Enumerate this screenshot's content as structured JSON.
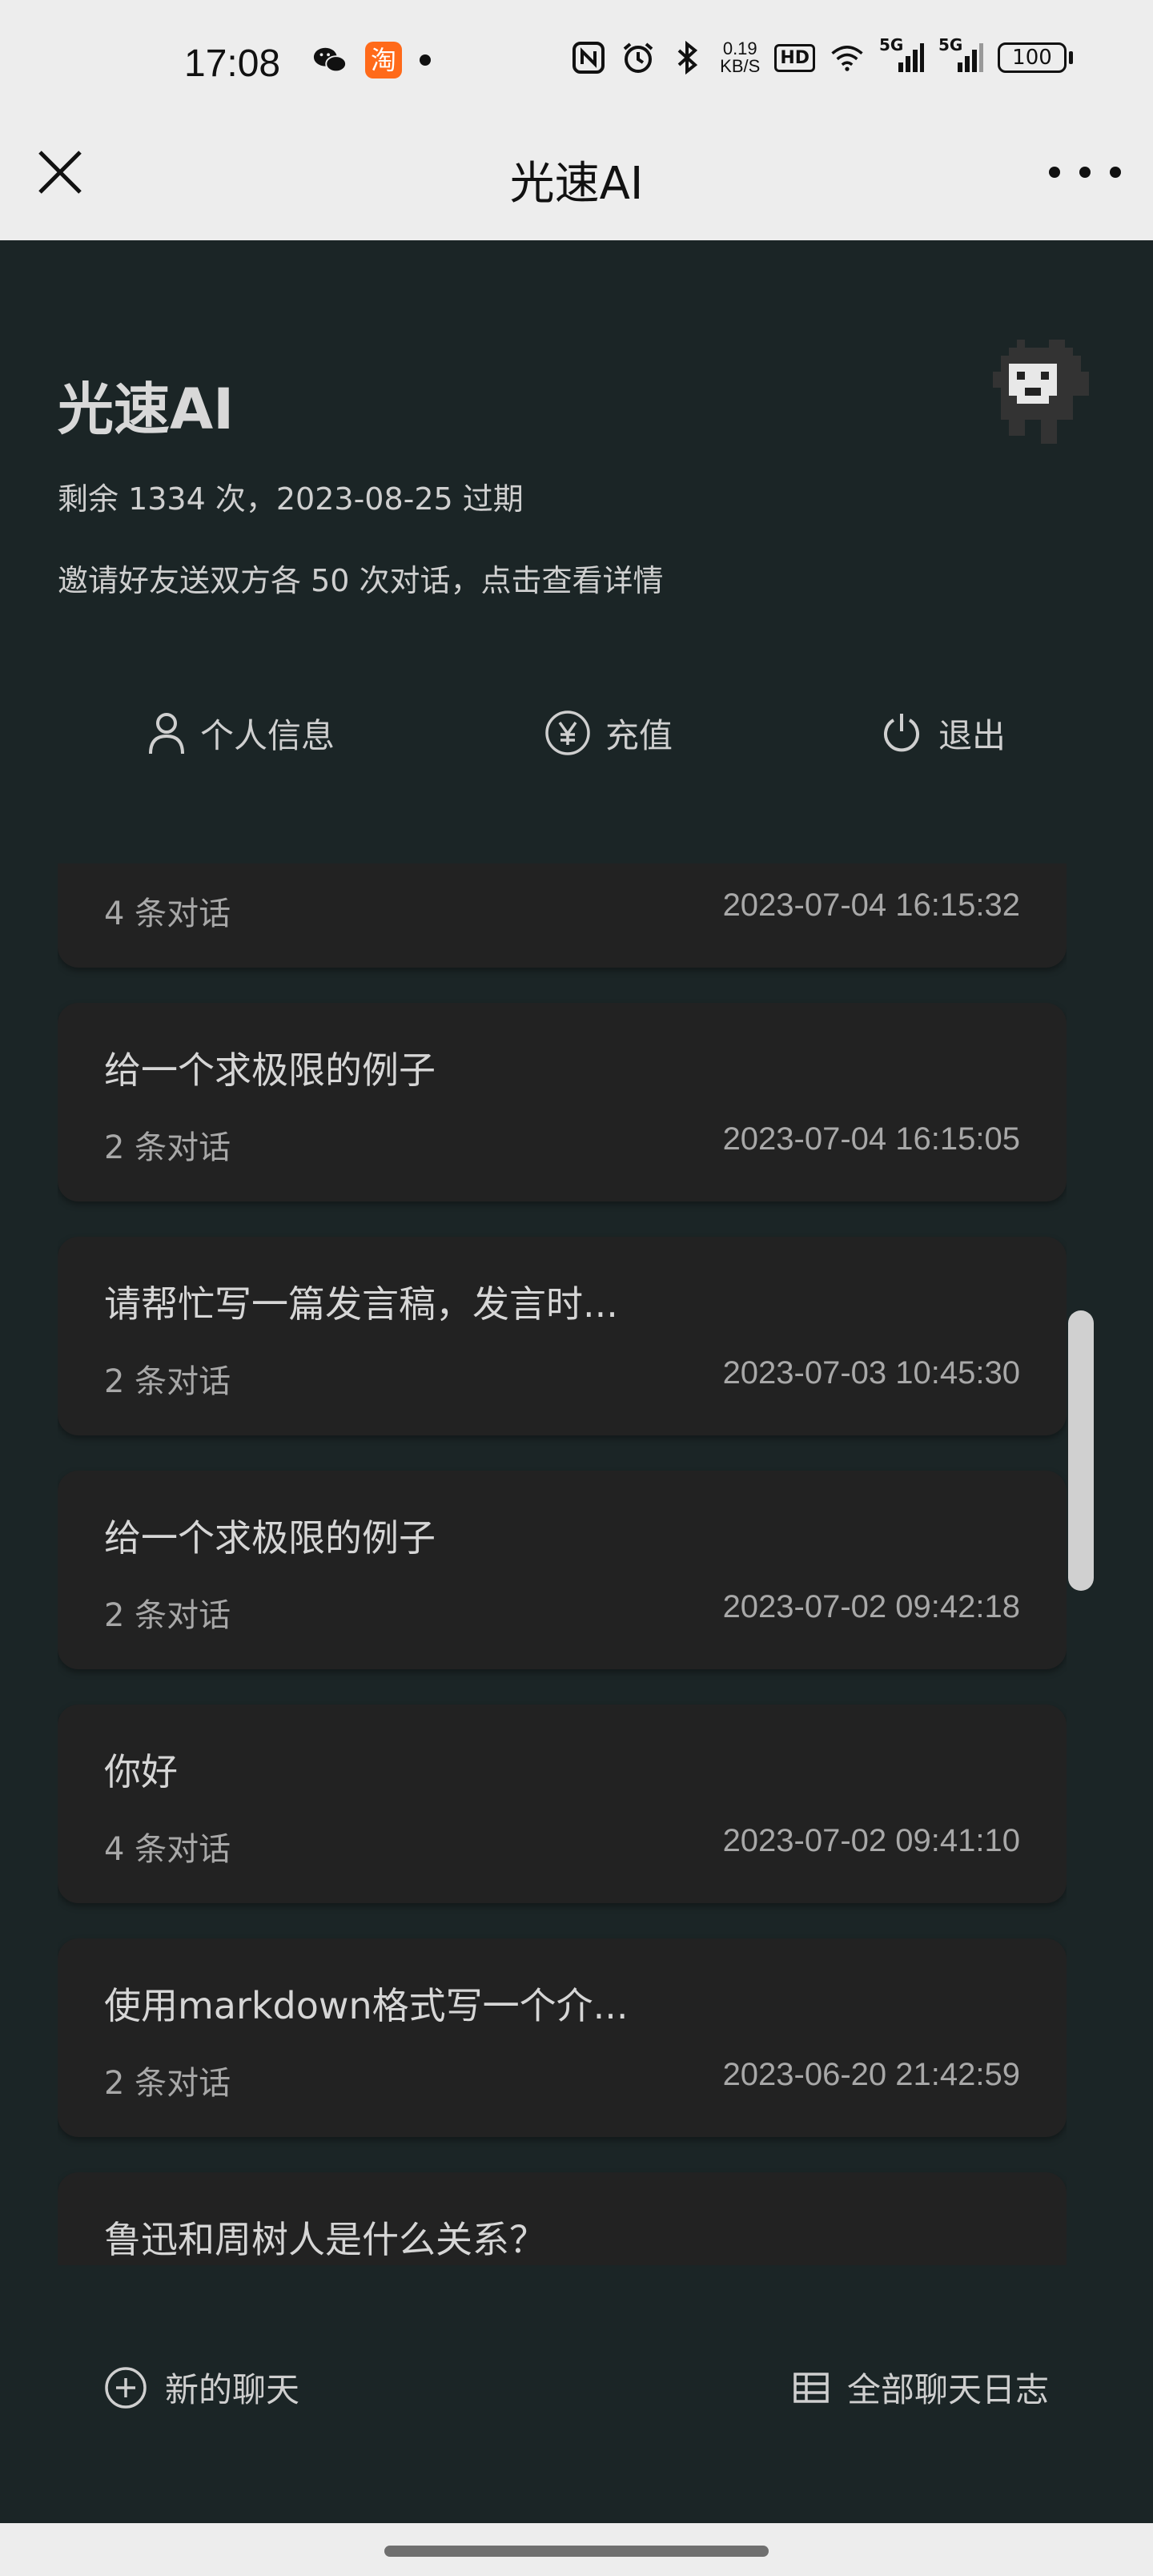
{
  "status_bar": {
    "time": "17:08",
    "taobao_glyph": "淘",
    "net_speed_value": "0.19",
    "net_speed_unit": "KB/S",
    "hd_label": "HD",
    "signal1_label": "5G",
    "signal2_label": "5G",
    "battery": "100",
    "icons": [
      "wechat-icon",
      "taobao-icon",
      "nfc-icon",
      "alarm-icon",
      "bluetooth-icon",
      "wifi-icon",
      "signal-icon",
      "battery-icon"
    ]
  },
  "title_bar": {
    "title": "光速AI"
  },
  "header": {
    "app_name": "光速AI",
    "remaining": "剩余 1334 次，2023-08-25 过期",
    "invite": "邀请好友送双方各 50 次对话，点击查看详情"
  },
  "actions": {
    "profile_label": "个人信息",
    "recharge_label": "充值",
    "logout_label": "退出"
  },
  "chats": [
    {
      "title": "",
      "count": "4 条对话",
      "date": "2023-07-04 16:15:32"
    },
    {
      "title": "给一个求极限的例子",
      "count": "2 条对话",
      "date": "2023-07-04 16:15:05"
    },
    {
      "title": "请帮忙写一篇发言稿，发言时...",
      "count": "2 条对话",
      "date": "2023-07-03 10:45:30"
    },
    {
      "title": "给一个求极限的例子",
      "count": "2 条对话",
      "date": "2023-07-02 09:42:18"
    },
    {
      "title": "你好",
      "count": "4 条对话",
      "date": "2023-07-02 09:41:10"
    },
    {
      "title": "使用markdown格式写一个介...",
      "count": "2 条对话",
      "date": "2023-06-20 21:42:59"
    },
    {
      "title": "鲁迅和周树人是什么关系？",
      "count": "",
      "date": ""
    }
  ],
  "footer": {
    "new_chat_label": "新的聊天",
    "all_logs_label": "全部聊天日志"
  },
  "colors": {
    "background": "#1b2526",
    "card": "#222222",
    "text": "#cfcfcf",
    "bar": "#ededed"
  }
}
